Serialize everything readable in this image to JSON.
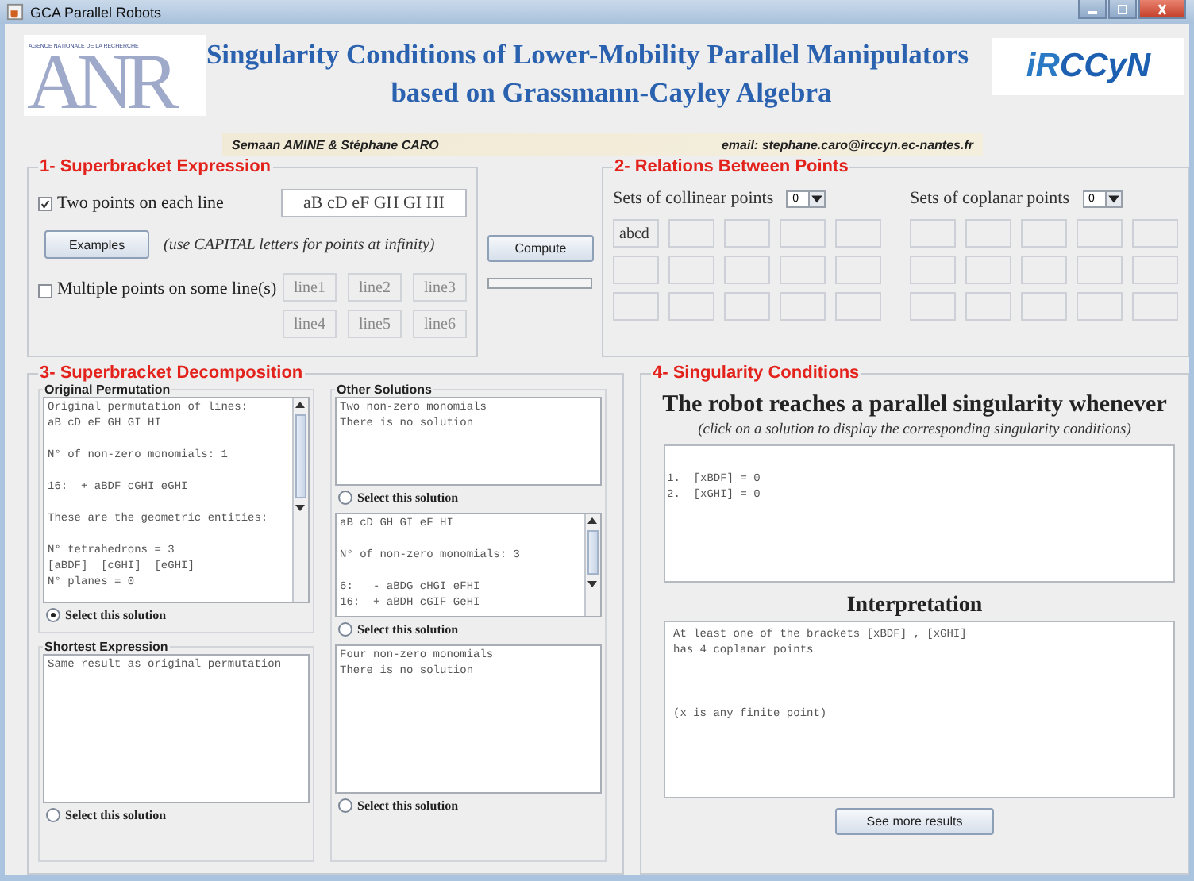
{
  "window": {
    "title": "GCA Parallel Robots"
  },
  "header": {
    "left_logo": {
      "caption": "AGENCE NATIONALE DE LA RECHERCHE",
      "letters": "ANR"
    },
    "title_lines": [
      "Singularity Conditions of Lower-Mobility Parallel Manipulators",
      "based on Grassmann-Cayley Algebra"
    ],
    "right_logo": {
      "letters_a": "iR",
      "letters_b": "CCyN"
    },
    "authors": "Semaan AMINE & Stéphane CARO",
    "email": "email: stephane.caro@irccyn.ec-nantes.fr"
  },
  "section1": {
    "title": "1- Superbracket Expression",
    "two_points": {
      "label": "Two points on each line",
      "checked": true
    },
    "expression": "aB cD eF GH GI HI",
    "examples_button": "Examples",
    "hint": "(use CAPITAL letters for points at infinity)",
    "multiple_points": {
      "label": "Multiple points on some line(s)",
      "checked": false
    },
    "line_fields": [
      "line1",
      "line2",
      "line3",
      "line4",
      "line5",
      "line6"
    ]
  },
  "compute_button": "Compute",
  "progress": {
    "level": 0
  },
  "section2": {
    "title": "2- Relations Between Points",
    "collinear": {
      "label": "Sets of collinear points",
      "count": "0",
      "cells": [
        "abcd"
      ]
    },
    "coplanar": {
      "label": "Sets of coplanar points",
      "count": "0"
    }
  },
  "section3": {
    "title": "3- Superbracket Decomposition",
    "original": {
      "title": "Original Permutation",
      "scrollable": true,
      "selected": true,
      "radio_label": "Select this solution",
      "paragraphs": [
        [
          "Original permutation of lines:",
          "aB cD eF GH GI HI"
        ],
        [
          "N° of non-zero monomials: 1"
        ],
        [
          "16:  + aBDF cGHI eGHI"
        ],
        [
          "These are the geometric entities:"
        ],
        [
          "N° tetrahedrons = 3",
          "[aBDF]  [cGHI]  [eGHI]",
          "N° planes = 0"
        ]
      ]
    },
    "shortest": {
      "title": "Shortest Expression",
      "scrollable": false,
      "selected": false,
      "radio_label": "Select this solution",
      "paragraphs": [
        [
          "Same result as original permutation"
        ]
      ]
    },
    "other": {
      "title": "Other Solutions",
      "solutions": [
        {
          "scrollable": false,
          "selected": false,
          "radio_label": "Select this solution",
          "paragraphs": [
            [
              "Two non-zero monomials",
              "There is no solution"
            ]
          ]
        },
        {
          "scrollable": true,
          "selected": false,
          "radio_label": "Select this solution",
          "paragraphs": [
            [
              "aB cD GH GI eF HI"
            ],
            [
              "N° of non-zero monomials: 3"
            ],
            [
              "6:   - aBDG cHGI eFHI",
              "16:  + aBDH cGIF GeHI"
            ]
          ]
        },
        {
          "scrollable": false,
          "selected": false,
          "radio_label": "Select this solution",
          "paragraphs": [
            [
              "Four non-zero monomials",
              "There is no solution"
            ]
          ]
        }
      ]
    }
  },
  "section4": {
    "title": "4- Singularity Conditions",
    "heading": "The robot reaches a parallel singularity whenever",
    "hint": "(click on a solution to display the corresponding singularity conditions)",
    "conditions": [
      "1.  [xBDF] = 0",
      "2.  [xGHI] = 0"
    ],
    "interpretation_title": "Interpretation",
    "interpretation": [
      [
        "At least one of the brackets [xBDF] , [xGHI]",
        "has 4 coplanar points"
      ],
      [
        "(x is any finite point)"
      ]
    ],
    "more_button": "See more results"
  }
}
